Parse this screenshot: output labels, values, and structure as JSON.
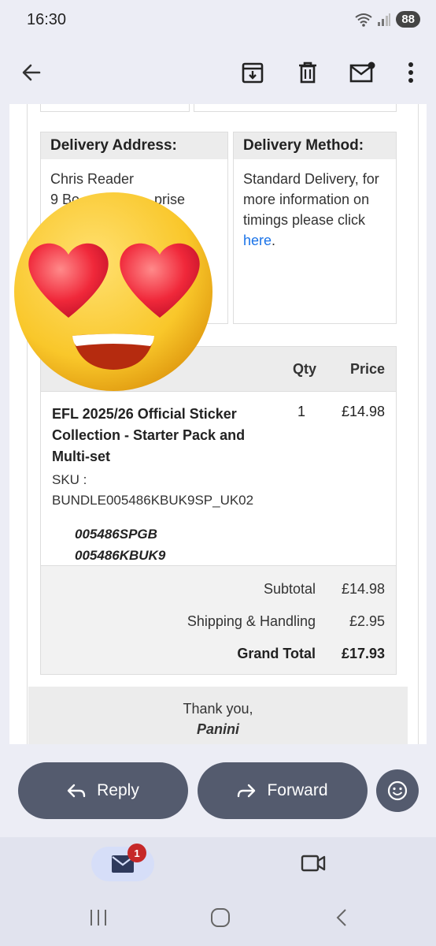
{
  "status_bar": {
    "time": "16:30",
    "battery": "88"
  },
  "app_bar": {
    "back_icon": "arrow-back-icon",
    "archive_icon": "archive-icon",
    "delete_icon": "trash-icon",
    "mark_unread_icon": "mail-unread-icon",
    "more_icon": "more-vert-icon"
  },
  "email": {
    "delivery_address": {
      "heading": "Delivery Address:",
      "name": "Chris Reader",
      "line1": "9 Bo                   prise"
    },
    "delivery_method": {
      "heading": "Delivery Method:",
      "text": "Standard Delivery, for more information on timings please click",
      "link": "here",
      "after_link": "."
    },
    "table": {
      "col_qty": "Qty",
      "col_price": "Price"
    },
    "item": {
      "name": "EFL 2025/26 Official Sticker Collection - Starter Pack and Multi-set",
      "qty": "1",
      "price": "£14.98",
      "sku_label": "SKU :",
      "sku": "BUNDLE005486KBUK9SP_UK02",
      "codes": [
        "005486SPGB",
        "005486KBUK9"
      ]
    },
    "totals": {
      "subtotal_label": "Subtotal",
      "subtotal_value": "£14.98",
      "shipping_label": "Shipping & Handling",
      "shipping_value": "£2.95",
      "grand_label": "Grand Total",
      "grand_value": "£17.93"
    },
    "footer": {
      "thanks": "Thank you,",
      "signature": "Panini"
    }
  },
  "actions": {
    "reply": "Reply",
    "forward": "Forward",
    "emoji_icon": "emoji-reaction-icon"
  },
  "bottom_nav": {
    "mail_badge": "1",
    "mail_icon": "mail-icon",
    "meet_icon": "video-camera-icon"
  },
  "sticker": "heart-eyes-emoji",
  "colors": {
    "accent": "#545b6e",
    "link": "#1a73e8",
    "badge": "#c62828"
  }
}
